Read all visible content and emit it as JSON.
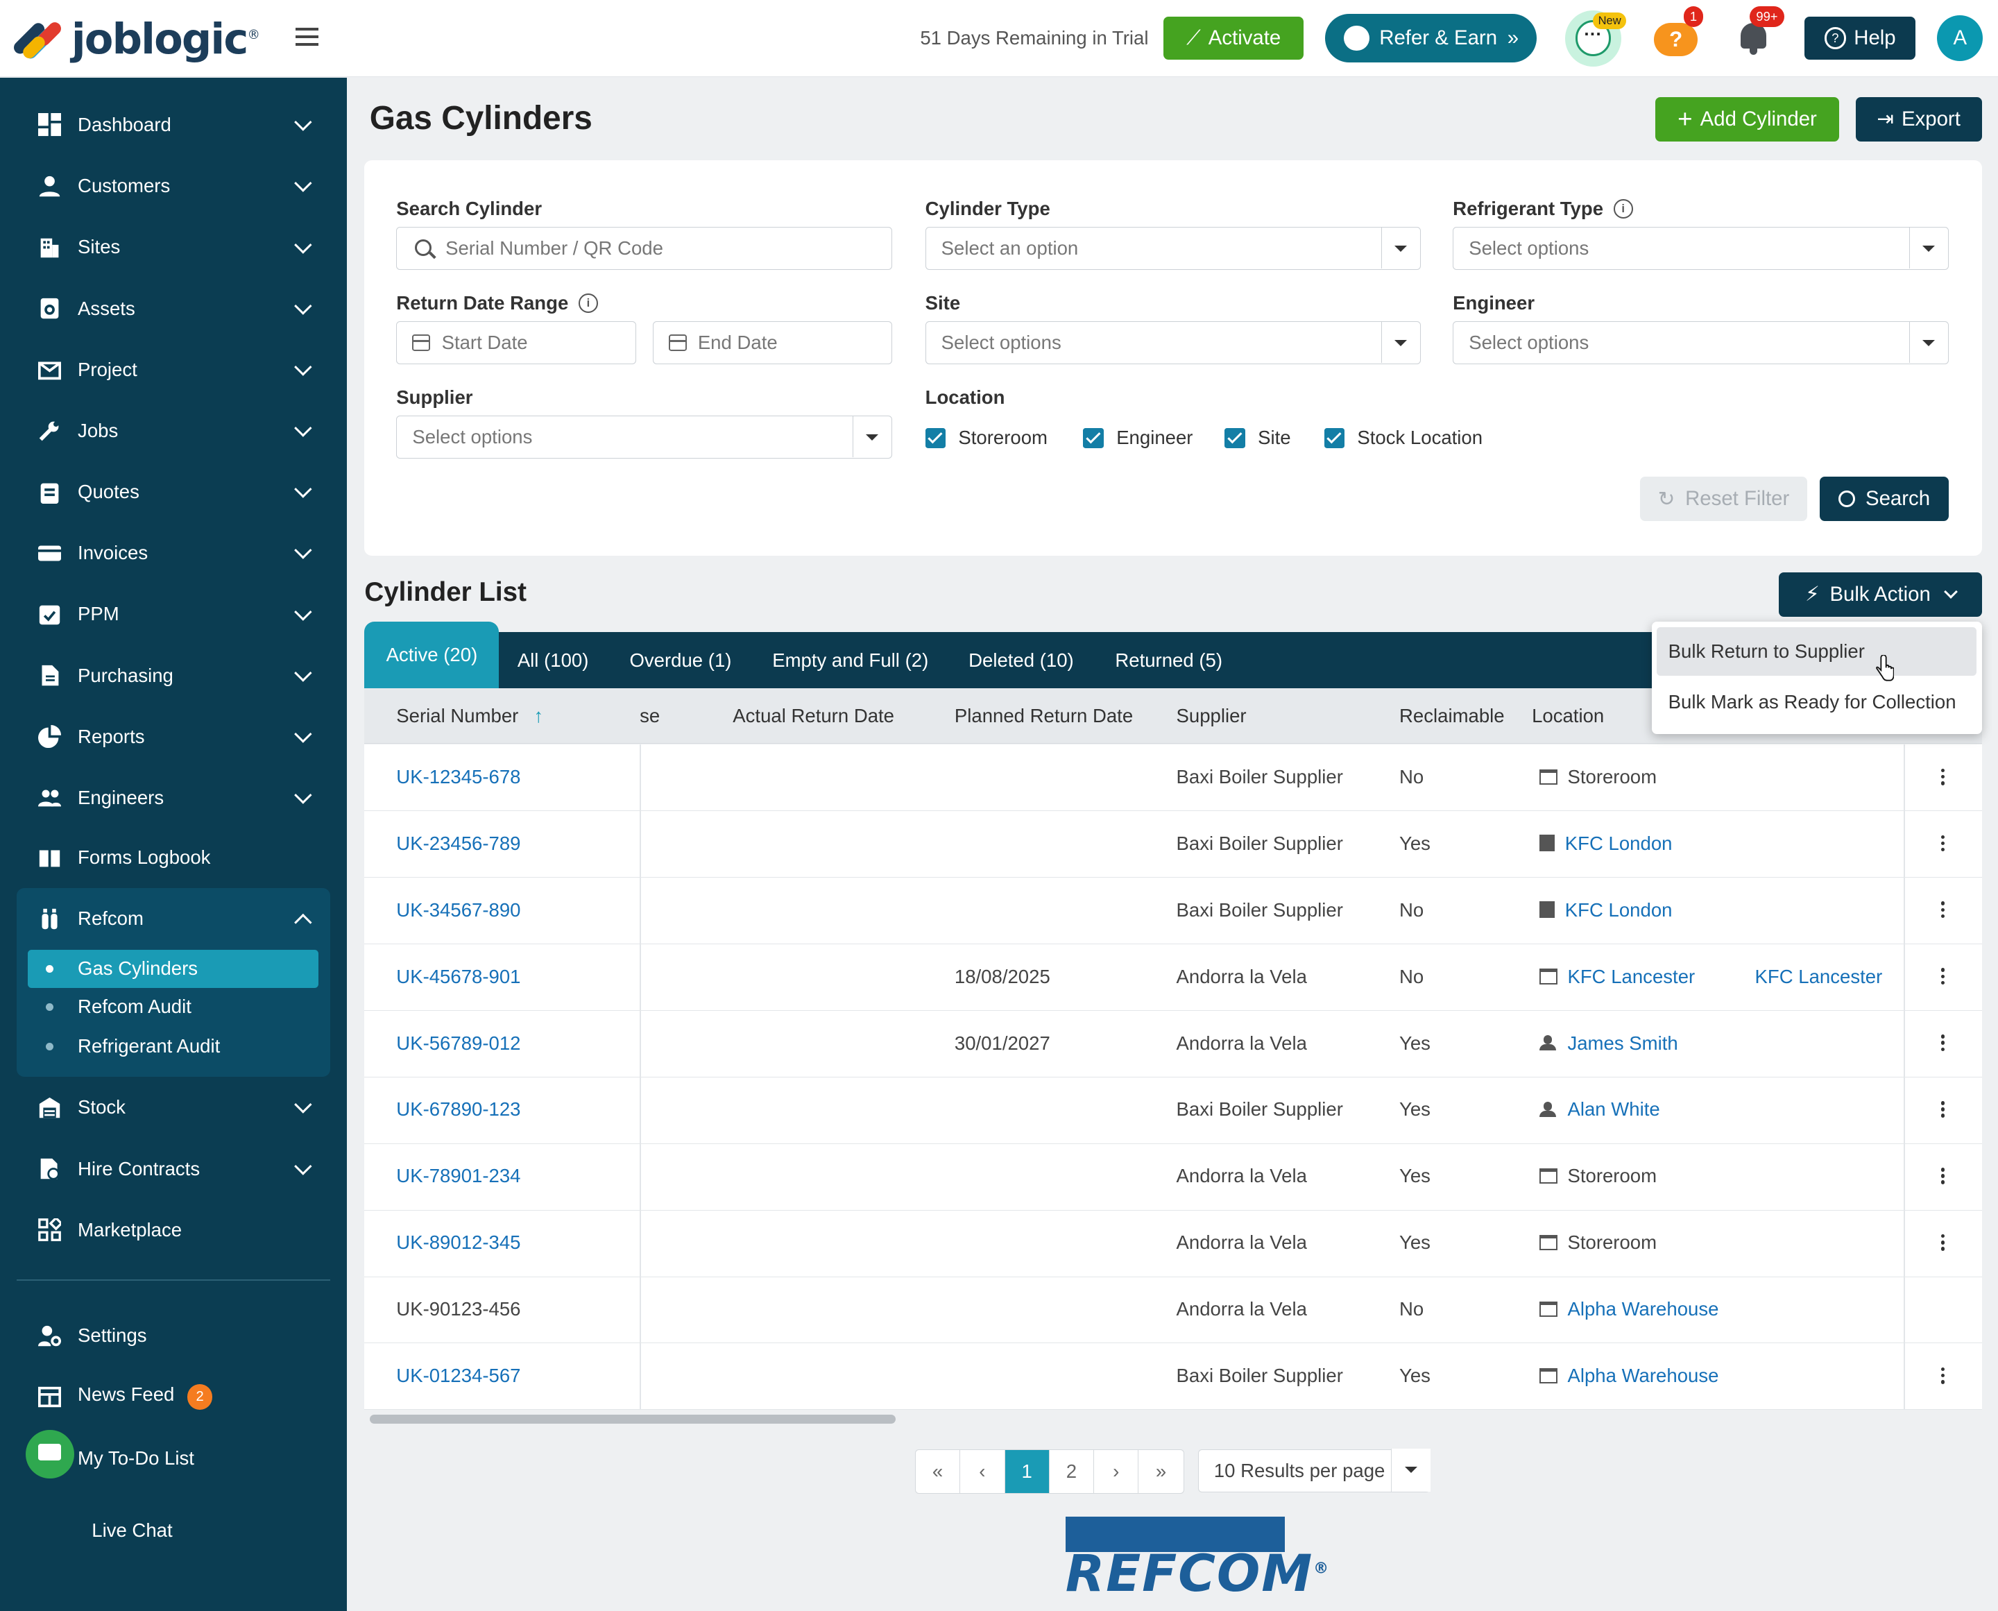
{
  "brand": {
    "name": "joblogic",
    "reg": "®"
  },
  "header": {
    "trial_text": "51 Days Remaining in Trial",
    "activate_label": "Activate",
    "refer_label": "Refer & Earn",
    "chat_new_badge": "New",
    "help_badge": "1",
    "notif_badge": "99+",
    "help_label": "Help",
    "avatar_initial": "A"
  },
  "sidebar": {
    "items": [
      {
        "label": "Dashboard",
        "icon": "dashboard-icon"
      },
      {
        "label": "Customers",
        "icon": "person-icon"
      },
      {
        "label": "Sites",
        "icon": "building-icon"
      },
      {
        "label": "Assets",
        "icon": "assets-icon"
      },
      {
        "label": "Project",
        "icon": "project-icon"
      },
      {
        "label": "Jobs",
        "icon": "wrench-icon"
      },
      {
        "label": "Quotes",
        "icon": "clipboard-icon"
      },
      {
        "label": "Invoices",
        "icon": "card-icon"
      },
      {
        "label": "PPM",
        "icon": "calendar-check-icon"
      },
      {
        "label": "Purchasing",
        "icon": "document-icon"
      },
      {
        "label": "Reports",
        "icon": "pie-chart-icon"
      },
      {
        "label": "Engineers",
        "icon": "people-icon"
      },
      {
        "label": "Forms Logbook",
        "icon": "book-icon"
      },
      {
        "label": "Refcom",
        "icon": "cylinder-icon"
      }
    ],
    "refcom_sub": [
      {
        "label": "Gas Cylinders",
        "active": true
      },
      {
        "label": "Refcom Audit",
        "active": false
      },
      {
        "label": "Refrigerant Audit",
        "active": false
      }
    ],
    "lower_items": [
      {
        "label": "Stock",
        "icon": "warehouse-icon"
      },
      {
        "label": "Hire Contracts",
        "icon": "contract-icon"
      },
      {
        "label": "Marketplace",
        "icon": "grid-icon"
      }
    ],
    "bottom_items": [
      {
        "label": "Settings",
        "icon": "settings-icon"
      },
      {
        "label": "News Feed",
        "icon": "news-icon",
        "badge": "2"
      },
      {
        "label": "My To-Do List",
        "icon": "todo-icon"
      }
    ],
    "live_chat_label": "Live Chat"
  },
  "page": {
    "title": "Gas Cylinders",
    "add_label": "Add Cylinder",
    "export_label": "Export"
  },
  "filters": {
    "search_label": "Search Cylinder",
    "search_placeholder": "Serial Number / QR Code",
    "cyl_type_label": "Cylinder Type",
    "cyl_type_placeholder": "Select an option",
    "ref_type_label": "Refrigerant Type",
    "ref_type_placeholder": "Select options",
    "return_range_label": "Return Date Range",
    "start_placeholder": "Start Date",
    "end_placeholder": "End Date",
    "site_label": "Site",
    "site_placeholder": "Select options",
    "engineer_label": "Engineer",
    "engineer_placeholder": "Select options",
    "supplier_label": "Supplier",
    "supplier_placeholder": "Select options",
    "location_label": "Location",
    "locations": [
      "Storeroom",
      "Engineer",
      "Site",
      "Stock Location"
    ],
    "reset_label": "Reset Filter",
    "search_button": "Search"
  },
  "list": {
    "title": "Cylinder List",
    "bulk_label": "Bulk Action",
    "tabs": [
      "Active (20)",
      "All (100)",
      "Overdue (1)",
      "Empty and Full (2)",
      "Deleted (10)",
      "Returned (5)"
    ],
    "columns": [
      "Serial Number",
      "se",
      "Actual Return Date",
      "Planned Return Date",
      "Supplier",
      "Reclaimable",
      "Location"
    ],
    "rows": [
      {
        "serial": "UK-12345-678",
        "planned": "",
        "supplier": "Baxi Boiler Supplier",
        "reclaim": "No",
        "location": "Storeroom",
        "loc_type": "store",
        "loc_link": false,
        "extra": "",
        "serial_link": true,
        "kebab": true
      },
      {
        "serial": "UK-23456-789",
        "planned": "",
        "supplier": "Baxi Boiler Supplier",
        "reclaim": "Yes",
        "location": "KFC London",
        "loc_type": "bld",
        "loc_link": true,
        "extra": "",
        "serial_link": true,
        "kebab": true
      },
      {
        "serial": "UK-34567-890",
        "planned": "",
        "supplier": "Baxi Boiler Supplier",
        "reclaim": "No",
        "location": "KFC London",
        "loc_type": "bld",
        "loc_link": true,
        "extra": "",
        "serial_link": true,
        "kebab": true
      },
      {
        "serial": "UK-45678-901",
        "planned": "18/08/2025",
        "supplier": "Andorra la Vela",
        "reclaim": "No",
        "location": "KFC Lancester",
        "loc_type": "store",
        "loc_link": true,
        "extra": "KFC Lancester",
        "serial_link": true,
        "kebab": true
      },
      {
        "serial": "UK-56789-012",
        "planned": "30/01/2027",
        "supplier": "Andorra la Vela",
        "reclaim": "Yes",
        "location": "James Smith",
        "loc_type": "person",
        "loc_link": true,
        "extra": "",
        "serial_link": true,
        "kebab": true
      },
      {
        "serial": "UK-67890-123",
        "planned": "",
        "supplier": "Baxi Boiler Supplier",
        "reclaim": "Yes",
        "location": "Alan White",
        "loc_type": "person",
        "loc_link": true,
        "extra": "",
        "serial_link": true,
        "kebab": true
      },
      {
        "serial": "UK-78901-234",
        "planned": "",
        "supplier": "Andorra la Vela",
        "reclaim": "Yes",
        "location": "Storeroom",
        "loc_type": "store",
        "loc_link": false,
        "extra": "",
        "serial_link": true,
        "kebab": true
      },
      {
        "serial": "UK-89012-345",
        "planned": "",
        "supplier": "Andorra la Vela",
        "reclaim": "Yes",
        "location": "Storeroom",
        "loc_type": "store",
        "loc_link": false,
        "extra": "",
        "serial_link": true,
        "kebab": true
      },
      {
        "serial": "UK-90123-456",
        "planned": "",
        "supplier": "Andorra la Vela",
        "reclaim": "No",
        "location": "Alpha Warehouse",
        "loc_type": "store",
        "loc_link": true,
        "extra": "",
        "serial_link": false,
        "kebab": false
      },
      {
        "serial": "UK-01234-567",
        "planned": "",
        "supplier": "Baxi Boiler Supplier",
        "reclaim": "Yes",
        "location": "Alpha Warehouse",
        "loc_type": "store",
        "loc_link": true,
        "extra": "",
        "serial_link": true,
        "kebab": true
      }
    ]
  },
  "pagination": {
    "first": "«",
    "prev": "‹",
    "pages": [
      "1",
      "2"
    ],
    "next": "›",
    "last": "»",
    "per_page": "10 Results per page"
  },
  "bulk_menu": [
    "Bulk Return to Supplier",
    "Bulk Mark as Ready for Collection"
  ],
  "footer_logo": "REFCOM",
  "footer_logo_reg": "®",
  "colors": {
    "accent": "#1a9bb5",
    "navy": "#0c3a4f",
    "green": "#45a320",
    "link": "#1670b8"
  }
}
